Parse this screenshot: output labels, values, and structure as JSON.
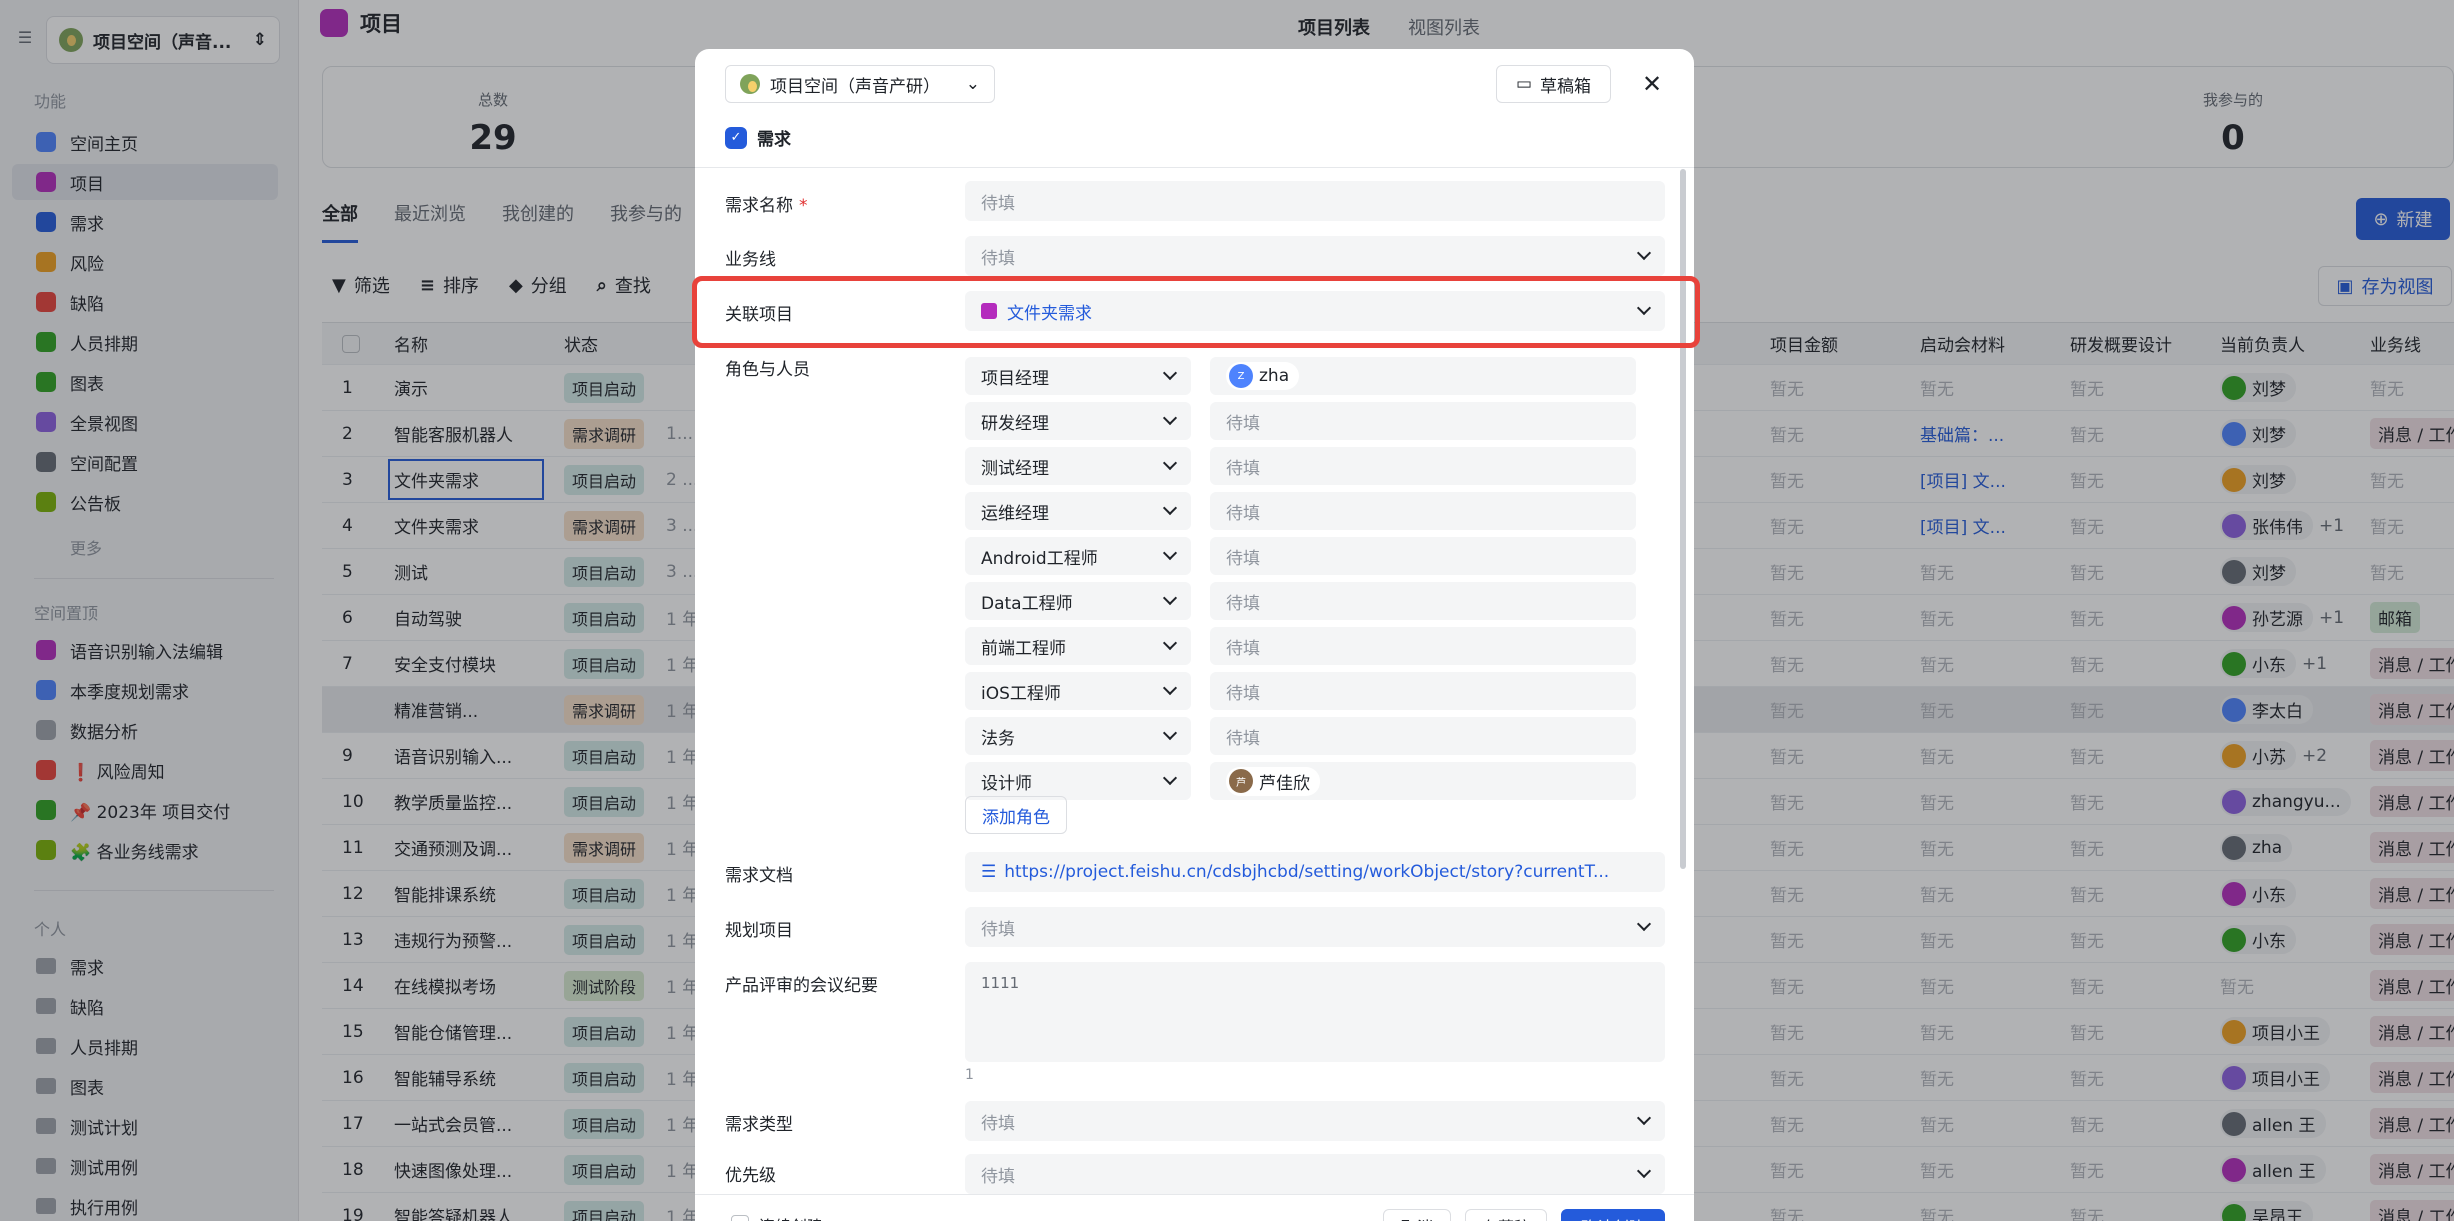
{
  "sidebar": {
    "space_name": "项目空间（声音...",
    "section_features": "功能",
    "items": [
      {
        "label": "空间主页",
        "color": "#4e83fd"
      },
      {
        "label": "项目",
        "color": "#b42bbd"
      },
      {
        "label": "需求",
        "color": "#245bdb"
      },
      {
        "label": "风险",
        "color": "#f0a020"
      },
      {
        "label": "缺陷",
        "color": "#e8423b"
      },
      {
        "label": "人员排期",
        "color": "#2ea121"
      },
      {
        "label": "图表",
        "color": "#2ea121"
      },
      {
        "label": "全景视图",
        "color": "#8c60e0"
      },
      {
        "label": "空间配置",
        "color": "#646a73"
      },
      {
        "label": "公告板",
        "color": "#7cb305"
      }
    ],
    "more": "更多",
    "section_pinned": "空间置顶",
    "pinned": [
      {
        "label": "语音识别输入法编辑",
        "color": "#b42bbd"
      },
      {
        "label": "本季度规划需求",
        "color": "#4e83fd"
      },
      {
        "label": "数据分析",
        "color": "#9ea3ab"
      },
      {
        "label": "❗ 风险周知",
        "color": "#e8423b"
      },
      {
        "label": "📌 2023年 项目交付",
        "color": "#2ea121"
      },
      {
        "label": "🧩 各业务线需求",
        "color": "#7cb305"
      }
    ],
    "section_personal": "个人",
    "personal": [
      "需求",
      "缺陷",
      "人员排期",
      "图表",
      "测试计划",
      "测试用例",
      "执行用例"
    ]
  },
  "main": {
    "title": "项目",
    "view_tabs": [
      "项目列表",
      "视图列表"
    ],
    "stats": [
      {
        "label": "总数",
        "value": "29"
      },
      {
        "label": "我参与的",
        "value": "0"
      }
    ],
    "filter_tabs": [
      "全部",
      "最近浏览",
      "我创建的",
      "我参与的"
    ],
    "new_button": "新建",
    "toolbar": [
      "筛选",
      "排序",
      "分组",
      "查找"
    ],
    "save_view": "存为视图",
    "columns_left": [
      "名称",
      "状态"
    ],
    "columns_right": [
      "项目金额",
      "启动会材料",
      "研发概要设计",
      "当前负责人",
      "业务线"
    ],
    "rows": [
      {
        "n": "1",
        "name": "演示",
        "status": "项目启动",
        "st": "blue",
        "time": "",
        "amt": "暂无",
        "mat": "暂无",
        "design": "暂无",
        "owner": "刘梦",
        "extra": "",
        "biz": "暂无"
      },
      {
        "n": "2",
        "name": "智能客服机器人",
        "status": "需求调研",
        "st": "orange",
        "time": "1...",
        "amt": "暂无",
        "mat": "基础篇：...",
        "design": "暂无",
        "owner": "刘梦",
        "extra": "",
        "biz": "消息 / 工作"
      },
      {
        "n": "3",
        "name": "文件夹需求",
        "status": "项目启动",
        "st": "blue",
        "time": "2 ...",
        "amt": "暂无",
        "mat": "[项目] 文...",
        "design": "暂无",
        "owner": "刘梦",
        "extra": "",
        "biz": "暂无"
      },
      {
        "n": "4",
        "name": "文件夹需求",
        "status": "需求调研",
        "st": "orange",
        "time": "3 ...",
        "amt": "暂无",
        "mat": "[项目] 文...",
        "design": "暂无",
        "owner": "张伟伟",
        "extra": "+1",
        "biz": "暂无"
      },
      {
        "n": "5",
        "name": "测试",
        "status": "项目启动",
        "st": "blue",
        "time": "3 ...",
        "amt": "暂无",
        "mat": "暂无",
        "design": "暂无",
        "owner": "刘梦",
        "extra": "",
        "biz": "暂无"
      },
      {
        "n": "6",
        "name": "自动驾驶",
        "status": "项目启动",
        "st": "blue",
        "time": "1 年",
        "amt": "暂无",
        "mat": "暂无",
        "design": "暂无",
        "owner": "孙艺源",
        "extra": "+1",
        "biz": "邮箱"
      },
      {
        "n": "7",
        "name": "安全支付模块",
        "status": "项目启动",
        "st": "blue",
        "time": "1 年",
        "amt": "暂无",
        "mat": "暂无",
        "design": "暂无",
        "owner": "小东",
        "extra": "+1",
        "biz": "消息 / 工作"
      },
      {
        "n": "",
        "name": "精准营销...",
        "status": "需求调研",
        "st": "orange",
        "time": "1 年",
        "amt": "暂无",
        "mat": "暂无",
        "design": "暂无",
        "owner": "李太白",
        "extra": "",
        "biz": "消息 / 工作"
      },
      {
        "n": "9",
        "name": "语音识别输入...",
        "status": "项目启动",
        "st": "blue",
        "time": "1 年",
        "amt": "暂无",
        "mat": "暂无",
        "design": "暂无",
        "owner": "小苏",
        "extra": "+2",
        "biz": "消息 / 工作"
      },
      {
        "n": "10",
        "name": "教学质量监控...",
        "status": "项目启动",
        "st": "blue",
        "time": "1 年",
        "amt": "暂无",
        "mat": "暂无",
        "design": "暂无",
        "owner": "zhangyu...",
        "extra": "",
        "biz": "消息 / 工作"
      },
      {
        "n": "11",
        "name": "交通预测及调...",
        "status": "需求调研",
        "st": "orange",
        "time": "1 年",
        "amt": "暂无",
        "mat": "暂无",
        "design": "暂无",
        "owner": "zha",
        "extra": "",
        "biz": "消息 / 工作"
      },
      {
        "n": "12",
        "name": "智能排课系统",
        "status": "项目启动",
        "st": "blue",
        "time": "1 年",
        "amt": "暂无",
        "mat": "暂无",
        "design": "暂无",
        "owner": "小东",
        "extra": "",
        "biz": "消息 / 工作"
      },
      {
        "n": "13",
        "name": "违规行为预警...",
        "status": "项目启动",
        "st": "blue",
        "time": "1 年",
        "amt": "暂无",
        "mat": "暂无",
        "design": "暂无",
        "owner": "小东",
        "extra": "",
        "biz": "消息 / 工作"
      },
      {
        "n": "14",
        "name": "在线模拟考场",
        "status": "测试阶段",
        "st": "green",
        "time": "1 年",
        "amt": "暂无",
        "mat": "暂无",
        "design": "暂无",
        "owner": "",
        "extra": "",
        "biz": "消息 / 工作"
      },
      {
        "n": "15",
        "name": "智能仓储管理...",
        "status": "项目启动",
        "st": "blue",
        "time": "1 年",
        "amt": "暂无",
        "mat": "暂无",
        "design": "暂无",
        "owner": "项目小王",
        "extra": "",
        "biz": "消息 / 工作"
      },
      {
        "n": "16",
        "name": "智能辅导系统",
        "status": "项目启动",
        "st": "blue",
        "time": "1 年",
        "amt": "暂无",
        "mat": "暂无",
        "design": "暂无",
        "owner": "项目小王",
        "extra": "",
        "biz": "消息 / 工作"
      },
      {
        "n": "17",
        "name": "一站式会员管...",
        "status": "项目启动",
        "st": "blue",
        "time": "1 年",
        "amt": "暂无",
        "mat": "暂无",
        "design": "暂无",
        "owner": "allen 王",
        "extra": "",
        "biz": "消息 / 工作"
      },
      {
        "n": "18",
        "name": "快速图像处理...",
        "status": "项目启动",
        "st": "blue",
        "time": "1 年",
        "amt": "暂无",
        "mat": "暂无",
        "design": "暂无",
        "owner": "allen 王",
        "extra": "",
        "biz": "消息 / 工作"
      },
      {
        "n": "19",
        "name": "智能答疑机器人",
        "status": "项目启动",
        "st": "blue",
        "time": "1 年",
        "amt": "暂无",
        "mat": "暂无",
        "design": "暂无",
        "owner": "吴昂王",
        "extra": "",
        "biz": "消息 / 工作"
      }
    ],
    "owner_empty": "暂无"
  },
  "modal": {
    "space": "项目空间（声音产研）",
    "draft": "草稿箱",
    "type": "需求",
    "fields": {
      "name_label": "需求名称",
      "name_placeholder": "待填",
      "biz_label": "业务线",
      "biz_placeholder": "待填",
      "project_label": "关联项目",
      "project_value": "文件夹需求",
      "roles_label": "角色与人员",
      "doc_label": "需求文档",
      "doc_value": "https://project.feishu.cn/cdsbjhcbd/setting/workObject/story?currentT...",
      "plan_label": "规划项目",
      "plan_placeholder": "待填",
      "notes_label": "产品评审的会议纪要",
      "notes_value": "1111",
      "notes_count": "1",
      "reqtype_label": "需求类型",
      "reqtype_placeholder": "待填",
      "priority_label": "优先级",
      "priority_placeholder": "待填"
    },
    "roles": [
      {
        "role": "项目经理",
        "person": "zha",
        "av": "Z",
        "avc": "#4e83fd"
      },
      {
        "role": "研发经理",
        "person": "待填"
      },
      {
        "role": "测试经理",
        "person": "待填"
      },
      {
        "role": "运维经理",
        "person": "待填"
      },
      {
        "role": "Android工程师",
        "person": "待填"
      },
      {
        "role": "Data工程师",
        "person": "待填"
      },
      {
        "role": "前端工程师",
        "person": "待填"
      },
      {
        "role": "iOS工程师",
        "person": "待填"
      },
      {
        "role": "法务",
        "person": "待填"
      },
      {
        "role": "设计师",
        "person": "芦佳欣",
        "av": "芦",
        "avc": "#8a6a4a"
      }
    ],
    "add_role": "添加角色",
    "footer": {
      "continue": "连续创建",
      "cancel": "取消",
      "save_draft": "存草稿",
      "submit": "确认创建"
    }
  }
}
